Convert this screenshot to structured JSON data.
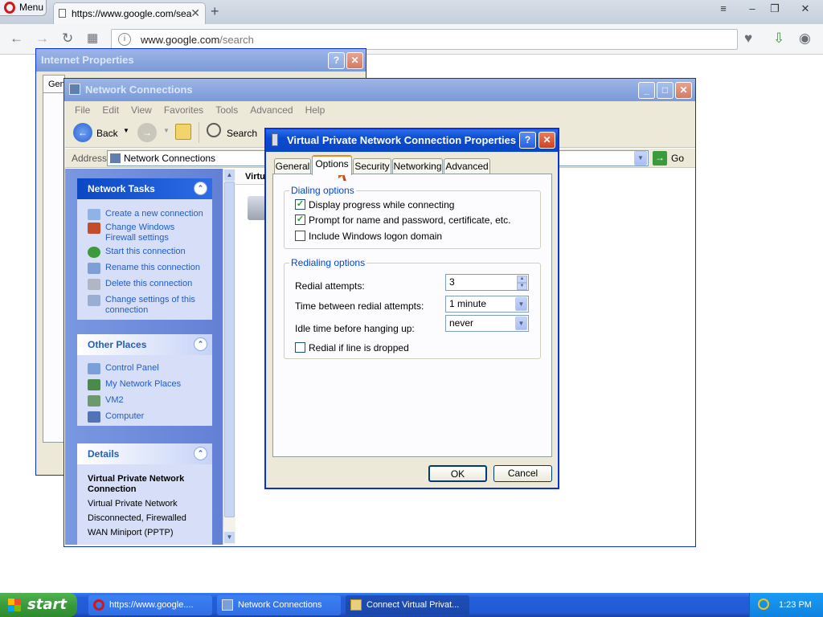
{
  "browser": {
    "menu_label": "Menu",
    "tab_title": "https://www.google.com/sea",
    "url_domain": "www.google.com",
    "url_path": "/search"
  },
  "internet_properties": {
    "title": "Internet Properties",
    "help": "?",
    "close": "✕",
    "tab_fragment": "Gen"
  },
  "network_connections": {
    "title": "Network Connections",
    "menu": [
      "File",
      "Edit",
      "View",
      "Favorites",
      "Tools",
      "Advanced",
      "Help"
    ],
    "toolbar": {
      "back": "Back",
      "search": "Search"
    },
    "address_label": "Address",
    "address_value": "Network Connections",
    "go_label": "Go",
    "list_header": "Virtu",
    "network_tasks": {
      "title": "Network Tasks",
      "items": [
        "Create a new connection",
        "Change Windows Firewall settings",
        "Start this connection",
        "Rename this connection",
        "Delete this connection",
        "Change settings of this connection"
      ]
    },
    "other_places": {
      "title": "Other Places",
      "items": [
        "Control Panel",
        "My Network Places",
        "VM2",
        "Computer"
      ]
    },
    "details": {
      "title": "Details",
      "name": "Virtual Private Network Connection",
      "lines": [
        "Virtual Private Network",
        "Disconnected, Firewalled",
        "WAN Miniport (PPTP)"
      ]
    }
  },
  "vpn_dialog": {
    "title": "Virtual Private Network Connection Properties",
    "help": "?",
    "close": "✕",
    "tabs": [
      "General",
      "Options",
      "Security",
      "Networking",
      "Advanced"
    ],
    "active_tab": "Options",
    "dialing": {
      "label": "Dialing options",
      "options": [
        {
          "label": "Display progress while connecting",
          "checked": true
        },
        {
          "label": "Prompt for name and password, certificate, etc.",
          "checked": true
        },
        {
          "label": "Include Windows logon domain",
          "checked": false
        }
      ]
    },
    "redialing": {
      "label": "Redialing options",
      "redial_attempts_label": "Redial attempts:",
      "redial_attempts_value": "3",
      "time_between_label": "Time between redial attempts:",
      "time_between_value": "1 minute",
      "idle_label": "Idle time before hanging up:",
      "idle_value": "never",
      "redial_if_dropped_label": "Redial if line is dropped",
      "redial_if_dropped_checked": false
    },
    "ok_label": "OK",
    "cancel_label": "Cancel"
  },
  "taskbar": {
    "start_label": "start",
    "tasks": [
      "https://www.google....",
      "Network Connections",
      "Connect Virtual Privat..."
    ],
    "clock": "1:23 PM"
  },
  "colors": {
    "xp_blue": "#0a4bd0",
    "task_pane_link": "#215dc6",
    "start_green": "#3a9b3a"
  }
}
